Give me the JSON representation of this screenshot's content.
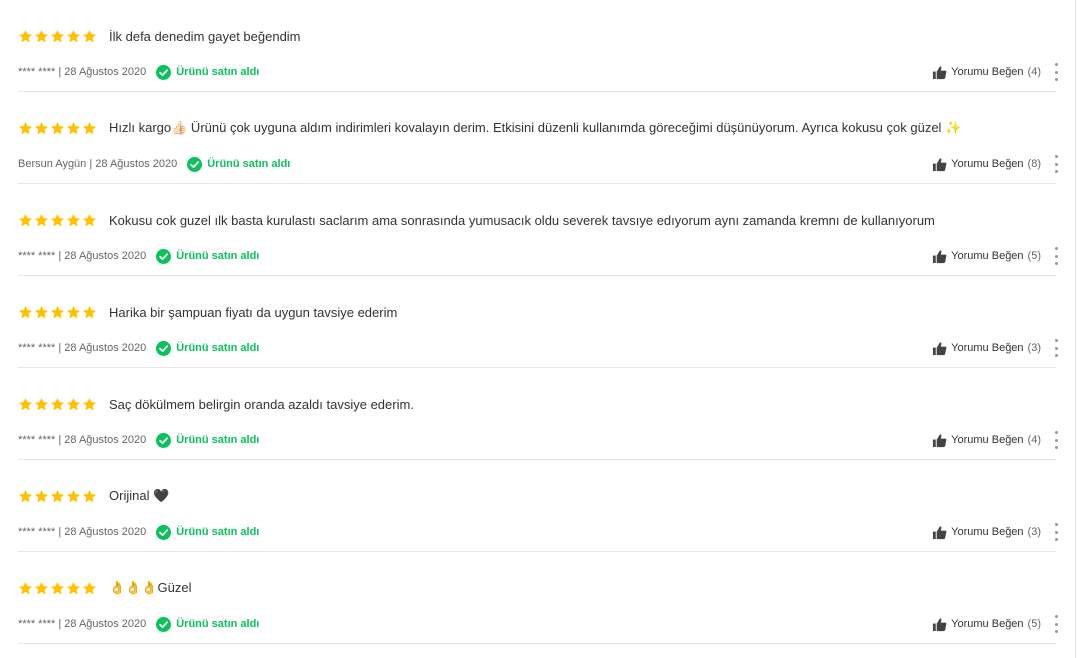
{
  "colors": {
    "star": "#ffc000",
    "verified": "#0bc15c",
    "text": "#333333",
    "divider": "#e6e6e6"
  },
  "icons": {
    "star": "star-icon",
    "verified": "check-circle-icon",
    "like": "thumbs-up-icon",
    "more": "more-vertical-icon"
  },
  "reviews": [
    {
      "rating": 5,
      "comment": "İlk defa denedim gayet beğendim",
      "meta": "**** **** | 28 Ağustos 2020",
      "verified_label": "Ürünü satın aldı",
      "like_label": "Yorumu Beğen",
      "like_count": "(4)"
    },
    {
      "rating": 5,
      "comment": "Hızlı kargo👍🏻 Ürünü çok uyguna aldım indirimleri kovalayın derim. Etkisini düzenli kullanımda göreceğimi düşünüyorum. Ayrıca kokusu çok güzel ✨",
      "meta": "Bersun Aygün | 28 Ağustos 2020",
      "verified_label": "Ürünü satın aldı",
      "like_label": "Yorumu Beğen",
      "like_count": "(8)"
    },
    {
      "rating": 5,
      "comment": "Kokusu cok guzel ılk basta kurulastı saclarım ama sonrasında yumusacık oldu severek tavsıye edıyorum aynı zamanda kremnı de kullanıyorum",
      "meta": "**** **** | 28 Ağustos 2020",
      "verified_label": "Ürünü satın aldı",
      "like_label": "Yorumu Beğen",
      "like_count": "(5)"
    },
    {
      "rating": 5,
      "comment": "Harika bir şampuan fiyatı da uygun tavsiye ederim",
      "meta": "**** **** | 28 Ağustos 2020",
      "verified_label": "Ürünü satın aldı",
      "like_label": "Yorumu Beğen",
      "like_count": "(3)"
    },
    {
      "rating": 5,
      "comment": "Saç dökülmem belirgin oranda azaldı tavsiye ederim.",
      "meta": "**** **** | 28 Ağustos 2020",
      "verified_label": "Ürünü satın aldı",
      "like_label": "Yorumu Beğen",
      "like_count": "(4)"
    },
    {
      "rating": 5,
      "comment": "Orijinal 🖤",
      "meta": "**** **** | 28 Ağustos 2020",
      "verified_label": "Ürünü satın aldı",
      "like_label": "Yorumu Beğen",
      "like_count": "(3)"
    },
    {
      "rating": 5,
      "comment": "👌👌👌Güzel",
      "meta": "**** **** | 28 Ağustos 2020",
      "verified_label": "Ürünü satın aldı",
      "like_label": "Yorumu Beğen",
      "like_count": "(5)"
    }
  ]
}
